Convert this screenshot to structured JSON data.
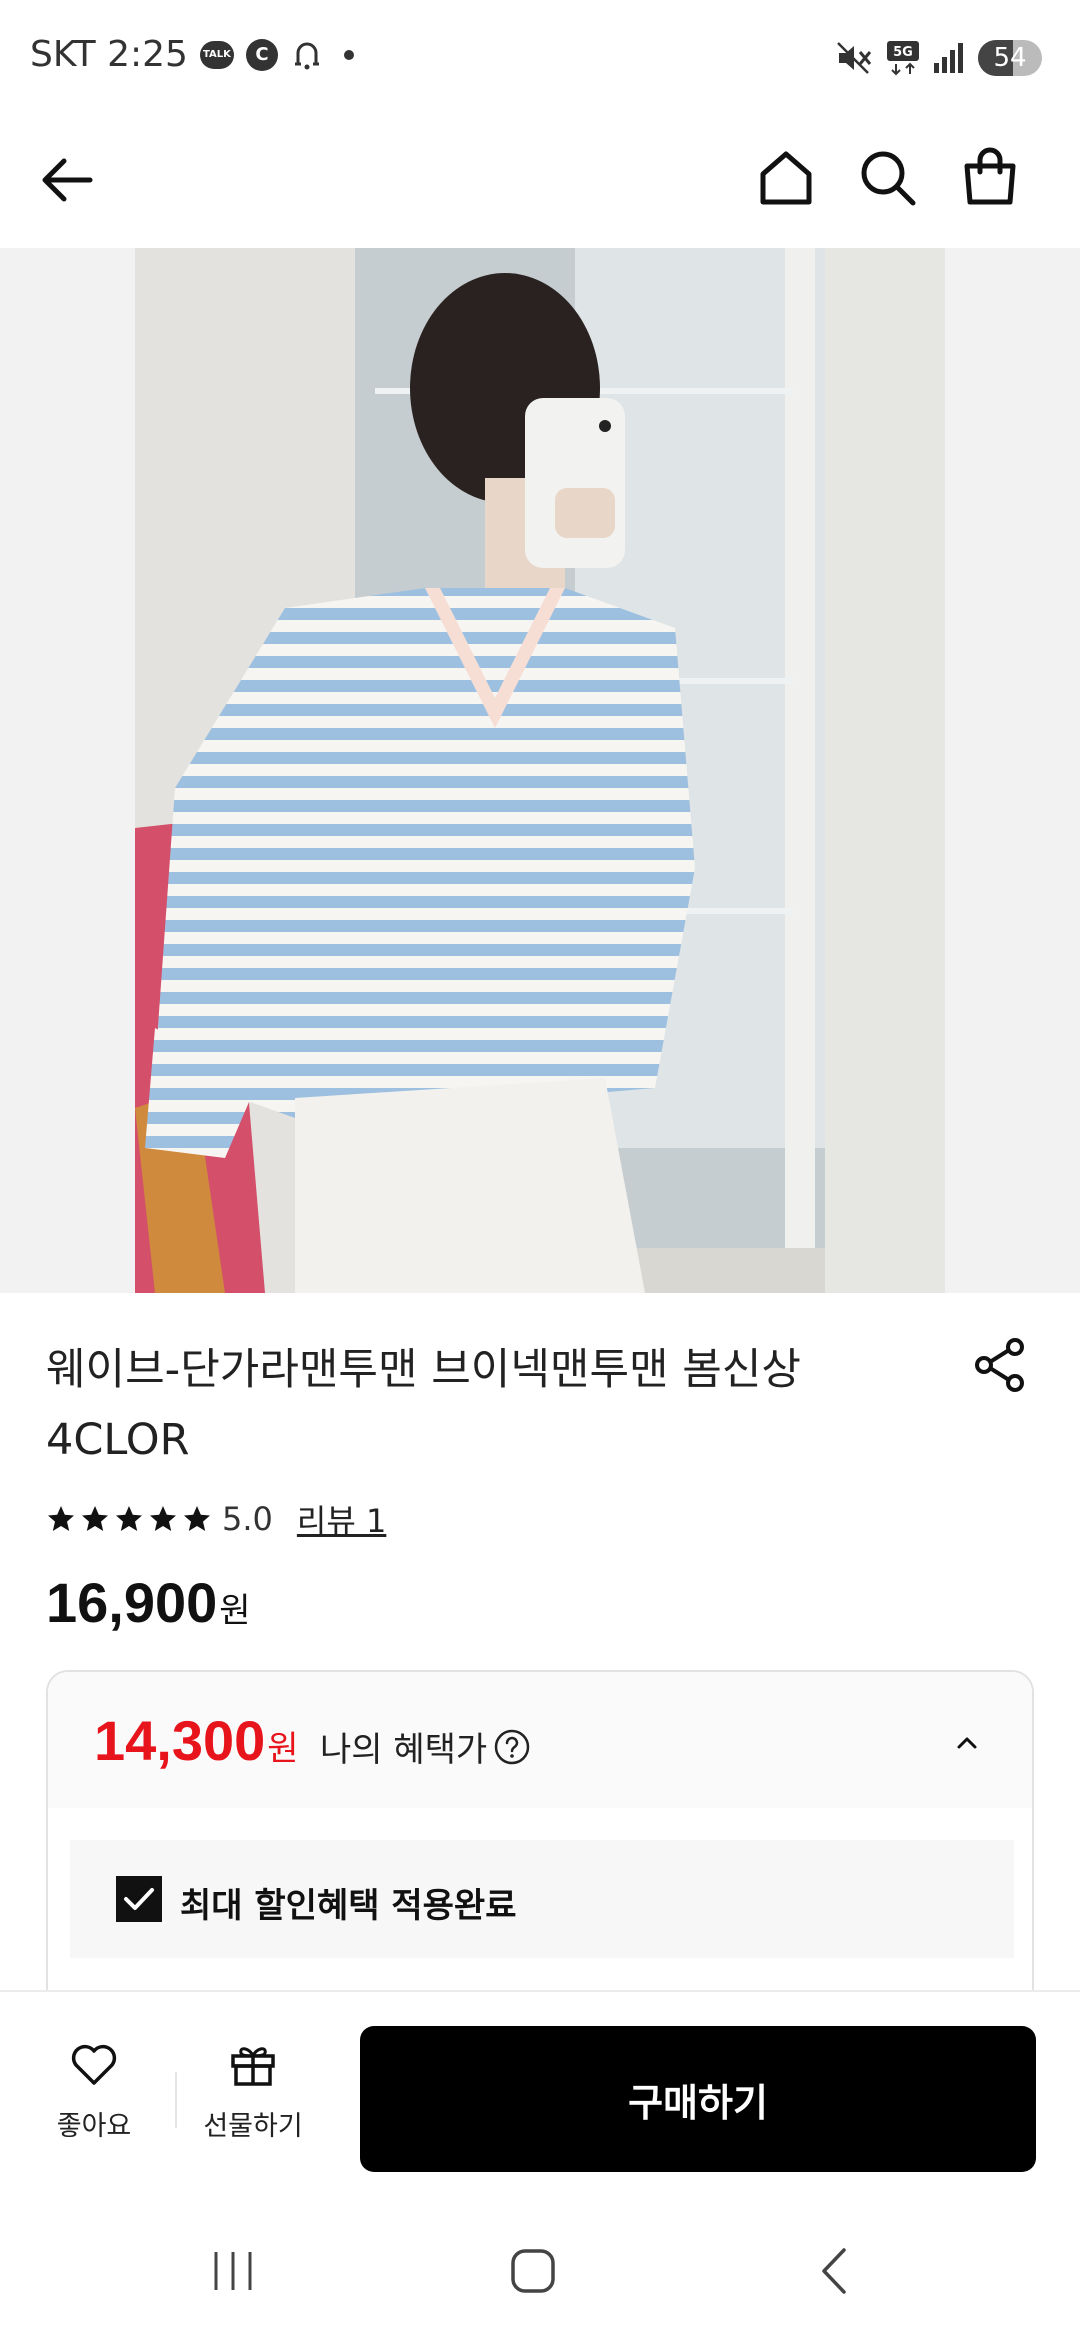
{
  "status_bar": {
    "carrier_time": "SKT 2:25",
    "talk_badge": "TALK",
    "c_badge": "C",
    "network": "5G",
    "battery": "54",
    "battery_level_percent": 54
  },
  "nav": {
    "icons": [
      "back-arrow-icon",
      "home-icon",
      "search-icon",
      "shopping-bag-icon"
    ]
  },
  "product": {
    "title": "웨이브-단가라맨투맨 브이넥맨투맨 봄신상 4CLOR",
    "rating_value": "5.0",
    "rating_stars": 5,
    "review_link": "리뷰 1",
    "price": "16,900",
    "price_unit": "원"
  },
  "benefit": {
    "price": "14,300",
    "price_unit": "원",
    "label": "나의 혜택가",
    "discount_text": "최대 할인혜택 적용완료",
    "discount_checked": true,
    "expanded": true
  },
  "bottom_bar": {
    "like_label": "좋아요",
    "gift_label": "선물하기",
    "buy_label": "구매하기"
  },
  "colors": {
    "accent_red": "#e8141c",
    "buy_button": "#000000",
    "stripe_blue": "#9ec0e0"
  }
}
